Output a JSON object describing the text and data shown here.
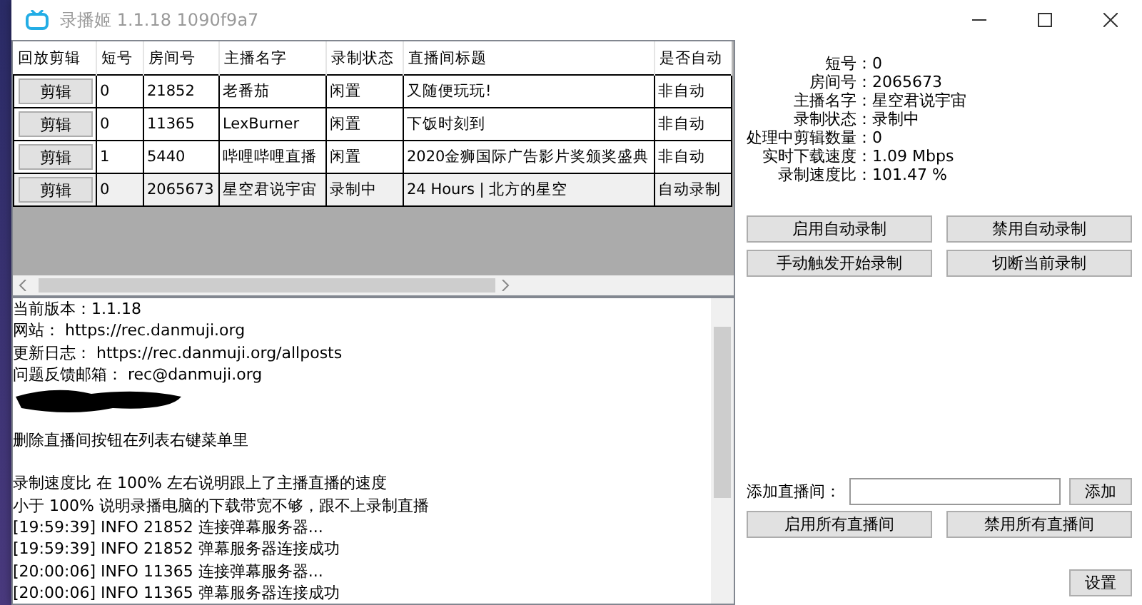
{
  "window": {
    "title": "录播姬 1.1.18 1090f9a7"
  },
  "table": {
    "columns": [
      "回放剪辑",
      "短号",
      "房间号",
      "主播名字",
      "录制状态",
      "直播间标题",
      "是否自动"
    ],
    "rows": [
      {
        "button": "剪辑",
        "short_id": "0",
        "room_id": "21852",
        "streamer": "老番茄",
        "status": "闲置",
        "title": "又随便玩玩!",
        "auto": "非自动",
        "selected": false
      },
      {
        "button": "剪辑",
        "short_id": "0",
        "room_id": "11365",
        "streamer": "LexBurner",
        "status": "闲置",
        "title": "下饭时刻到",
        "auto": "非自动",
        "selected": false
      },
      {
        "button": "剪辑",
        "short_id": "1",
        "room_id": "5440",
        "streamer": "哔哩哔哩直播",
        "status": "闲置",
        "title": "2020金狮国际广告影片奖颁奖盛典",
        "auto": "非自动",
        "selected": false
      },
      {
        "button": "剪辑",
        "short_id": "0",
        "room_id": "2065673",
        "streamer": "星空君说宇宙",
        "status": "录制中",
        "title": "24 Hours | 北方的星空",
        "auto": "自动录制",
        "selected": true
      }
    ]
  },
  "log": {
    "lines": [
      {
        "kind": "text",
        "text": "当前版本：1.1.18"
      },
      {
        "kind": "text",
        "text": "网站： https://rec.danmuji.org"
      },
      {
        "kind": "text",
        "text": "更新日志： https://rec.danmuji.org/allposts"
      },
      {
        "kind": "text",
        "text": "问题反馈邮箱： rec@danmuji.org"
      },
      {
        "kind": "redacted"
      },
      {
        "kind": "blank"
      },
      {
        "kind": "text",
        "text": "删除直播间按钮在列表右键菜单里"
      },
      {
        "kind": "blank"
      },
      {
        "kind": "text",
        "text": "录制速度比 在 100% 左右说明跟上了主播直播的速度"
      },
      {
        "kind": "text",
        "text": "小于 100% 说明录播电脑的下载带宽不够，跟不上录制直播"
      },
      {
        "kind": "text",
        "text": "[19:59:39] INFO 21852 连接弹幕服务器..."
      },
      {
        "kind": "text",
        "text": "[19:59:39] INFO 21852 弹幕服务器连接成功"
      },
      {
        "kind": "text",
        "text": "[20:00:06] INFO 11365 连接弹幕服务器..."
      },
      {
        "kind": "text",
        "text": "[20:00:06] INFO 11365 弹幕服务器连接成功"
      }
    ]
  },
  "details": [
    {
      "label": "短号：",
      "value": "0"
    },
    {
      "label": "房间号：",
      "value": "2065673"
    },
    {
      "label": "主播名字：",
      "value": "星空君说宇宙"
    },
    {
      "label": "录制状态：",
      "value": "录制中"
    },
    {
      "label": "处理中剪辑数量：",
      "value": "0"
    },
    {
      "label": "实时下载速度：",
      "value": "1.09 Mbps"
    },
    {
      "label": "录制速度比：",
      "value": "101.47 %"
    }
  ],
  "record_buttons": [
    "启用自动录制",
    "禁用自动录制",
    "手动触发开始录制",
    "切断当前录制"
  ],
  "add_room": {
    "label": "添加直播间：",
    "button": "添加"
  },
  "room_buttons": [
    "启用所有直播间",
    "禁用所有直播间"
  ],
  "settings_button": "设置"
}
